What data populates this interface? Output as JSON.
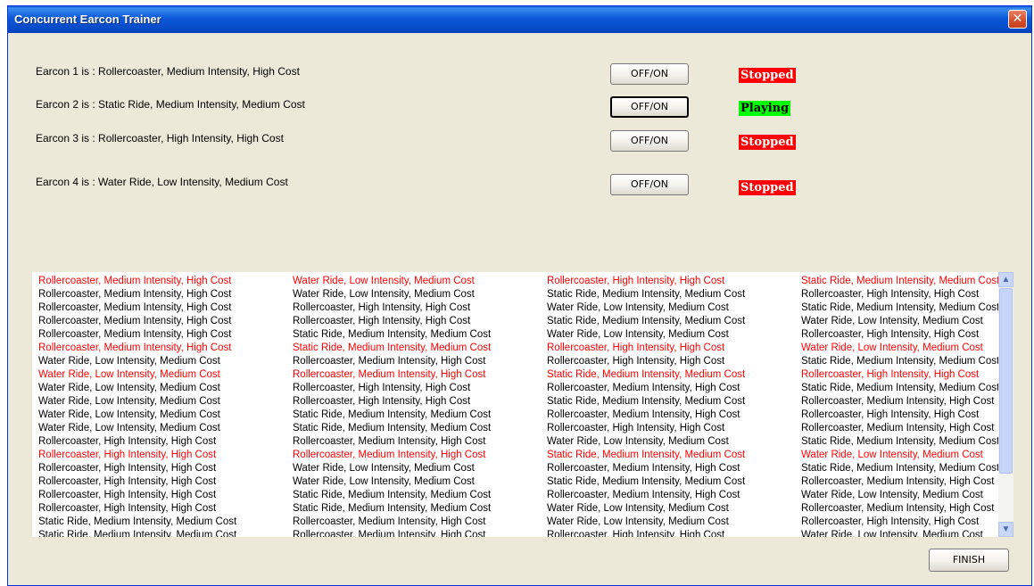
{
  "window": {
    "title": "Concurrent Earcon Trainer",
    "close_glyph": "✕"
  },
  "earcons": [
    {
      "label": "Earcon 1 is :  Rollercoaster, Medium Intensity, High Cost",
      "button": "OFF/ON",
      "status": "Stopped"
    },
    {
      "label": "Earcon 2 is :  Static Ride, Medium Intensity, Medium Cost",
      "button": "OFF/ON",
      "status": "Playing"
    },
    {
      "label": "Earcon 3 is :  Rollercoaster, High Intensity, High Cost",
      "button": "OFF/ON",
      "status": "Stopped"
    },
    {
      "label": "Earcon 4 is :  Water Ride, Low Intensity, Medium Cost",
      "button": "OFF/ON",
      "status": "Stopped"
    }
  ],
  "status_colors": {
    "Stopped": "#ff0000",
    "Playing": "#00ff00"
  },
  "list_highlight_color": "#ff0000",
  "list": {
    "columns": [
      [
        {
          "text": "Rollercoaster, Medium Intensity, High Cost",
          "red": true
        },
        {
          "text": "Rollercoaster, Medium Intensity, High Cost",
          "red": false
        },
        {
          "text": "Rollercoaster, Medium Intensity, High Cost",
          "red": false
        },
        {
          "text": "Rollercoaster, Medium Intensity, High Cost",
          "red": false
        },
        {
          "text": "Rollercoaster, Medium Intensity, High Cost",
          "red": false
        },
        {
          "text": "Rollercoaster, Medium Intensity, High Cost",
          "red": true
        },
        {
          "text": "Water Ride, Low Intensity, Medium Cost",
          "red": false
        },
        {
          "text": "Water Ride, Low Intensity, Medium Cost",
          "red": true
        },
        {
          "text": "Water Ride, Low Intensity, Medium Cost",
          "red": false
        },
        {
          "text": "Water Ride, Low Intensity, Medium Cost",
          "red": false
        },
        {
          "text": "Water Ride, Low Intensity, Medium Cost",
          "red": false
        },
        {
          "text": "Water Ride, Low Intensity, Medium Cost",
          "red": false
        },
        {
          "text": "Rollercoaster, High Intensity, High Cost",
          "red": false
        },
        {
          "text": "Rollercoaster, High Intensity, High Cost",
          "red": true
        },
        {
          "text": "Rollercoaster, High Intensity, High Cost",
          "red": false
        },
        {
          "text": "Rollercoaster, High Intensity, High Cost",
          "red": false
        },
        {
          "text": "Rollercoaster, High Intensity, High Cost",
          "red": false
        },
        {
          "text": "Rollercoaster, High Intensity, High Cost",
          "red": false
        },
        {
          "text": "Static Ride, Medium Intensity, Medium Cost",
          "red": false
        },
        {
          "text": "Static Ride, Medium Intensity, Medium Cost",
          "red": false
        }
      ],
      [
        {
          "text": "Water Ride, Low Intensity, Medium Cost",
          "red": true
        },
        {
          "text": "Water Ride, Low Intensity, Medium Cost",
          "red": false
        },
        {
          "text": "Rollercoaster, High Intensity, High Cost",
          "red": false
        },
        {
          "text": "Rollercoaster, High Intensity, High Cost",
          "red": false
        },
        {
          "text": "Static Ride, Medium Intensity, Medium Cost",
          "red": false
        },
        {
          "text": "Static Ride, Medium Intensity, Medium Cost",
          "red": true
        },
        {
          "text": "Rollercoaster, Medium Intensity, High Cost",
          "red": false
        },
        {
          "text": "Rollercoaster, Medium Intensity, High Cost",
          "red": true
        },
        {
          "text": "Rollercoaster, High Intensity, High Cost",
          "red": false
        },
        {
          "text": "Rollercoaster, High Intensity, High Cost",
          "red": false
        },
        {
          "text": "Static Ride, Medium Intensity, Medium Cost",
          "red": false
        },
        {
          "text": "Static Ride, Medium Intensity, Medium Cost",
          "red": false
        },
        {
          "text": "Rollercoaster, Medium Intensity, High Cost",
          "red": false
        },
        {
          "text": "Rollercoaster, Medium Intensity, High Cost",
          "red": true
        },
        {
          "text": "Water Ride, Low Intensity, Medium Cost",
          "red": false
        },
        {
          "text": "Water Ride, Low Intensity, Medium Cost",
          "red": false
        },
        {
          "text": "Static Ride, Medium Intensity, Medium Cost",
          "red": false
        },
        {
          "text": "Static Ride, Medium Intensity, Medium Cost",
          "red": false
        },
        {
          "text": "Rollercoaster, Medium Intensity, High Cost",
          "red": false
        },
        {
          "text": "Rollercoaster, Medium Intensity, High Cost",
          "red": false
        }
      ],
      [
        {
          "text": "Rollercoaster, High Intensity, High Cost",
          "red": true
        },
        {
          "text": "Static Ride, Medium Intensity, Medium Cost",
          "red": false
        },
        {
          "text": "Water Ride, Low Intensity, Medium Cost",
          "red": false
        },
        {
          "text": "Static Ride, Medium Intensity, Medium Cost",
          "red": false
        },
        {
          "text": "Water Ride, Low Intensity, Medium Cost",
          "red": false
        },
        {
          "text": "Rollercoaster, High Intensity, High Cost",
          "red": true
        },
        {
          "text": "Rollercoaster, High Intensity, High Cost",
          "red": false
        },
        {
          "text": "Static Ride, Medium Intensity, Medium Cost",
          "red": true
        },
        {
          "text": "Rollercoaster, Medium Intensity, High Cost",
          "red": false
        },
        {
          "text": "Static Ride, Medium Intensity, Medium Cost",
          "red": false
        },
        {
          "text": "Rollercoaster, Medium Intensity, High Cost",
          "red": false
        },
        {
          "text": "Rollercoaster, High Intensity, High Cost",
          "red": false
        },
        {
          "text": "Water Ride, Low Intensity, Medium Cost",
          "red": false
        },
        {
          "text": "Static Ride, Medium Intensity, Medium Cost",
          "red": true
        },
        {
          "text": "Rollercoaster, Medium Intensity, High Cost",
          "red": false
        },
        {
          "text": "Static Ride, Medium Intensity, Medium Cost",
          "red": false
        },
        {
          "text": "Rollercoaster, Medium Intensity, High Cost",
          "red": false
        },
        {
          "text": "Water Ride, Low Intensity, Medium Cost",
          "red": false
        },
        {
          "text": "Water Ride, Low Intensity, Medium Cost",
          "red": false
        },
        {
          "text": "Rollercoaster, High Intensity, High Cost",
          "red": false
        }
      ],
      [
        {
          "text": "Static Ride, Medium Intensity, Medium Cost",
          "red": true
        },
        {
          "text": "Rollercoaster, High Intensity, High Cost",
          "red": false
        },
        {
          "text": "Static Ride, Medium Intensity, Medium Cost",
          "red": false
        },
        {
          "text": "Water Ride, Low Intensity, Medium Cost",
          "red": false
        },
        {
          "text": "Rollercoaster, High Intensity, High Cost",
          "red": false
        },
        {
          "text": "Water Ride, Low Intensity, Medium Cost",
          "red": true
        },
        {
          "text": "Static Ride, Medium Intensity, Medium Cost",
          "red": false
        },
        {
          "text": "Rollercoaster, High Intensity, High Cost",
          "red": true
        },
        {
          "text": "Static Ride, Medium Intensity, Medium Cost",
          "red": false
        },
        {
          "text": "Rollercoaster, Medium Intensity, High Cost",
          "red": false
        },
        {
          "text": "Rollercoaster, High Intensity, High Cost",
          "red": false
        },
        {
          "text": "Rollercoaster, Medium Intensity, High Cost",
          "red": false
        },
        {
          "text": "Static Ride, Medium Intensity, Medium Cost",
          "red": false
        },
        {
          "text": "Water Ride, Low Intensity, Medium Cost",
          "red": true
        },
        {
          "text": "Static Ride, Medium Intensity, Medium Cost",
          "red": false
        },
        {
          "text": "Rollercoaster, Medium Intensity, High Cost",
          "red": false
        },
        {
          "text": "Water Ride, Low Intensity, Medium Cost",
          "red": false
        },
        {
          "text": "Rollercoaster, Medium Intensity, High Cost",
          "red": false
        },
        {
          "text": "Rollercoaster, High Intensity, High Cost",
          "red": false
        },
        {
          "text": "Water Ride, Low Intensity, Medium Cost",
          "red": false
        }
      ]
    ]
  },
  "scroll_up_glyph": "▲",
  "scroll_down_glyph": "▼",
  "finish_label": "FINISH"
}
